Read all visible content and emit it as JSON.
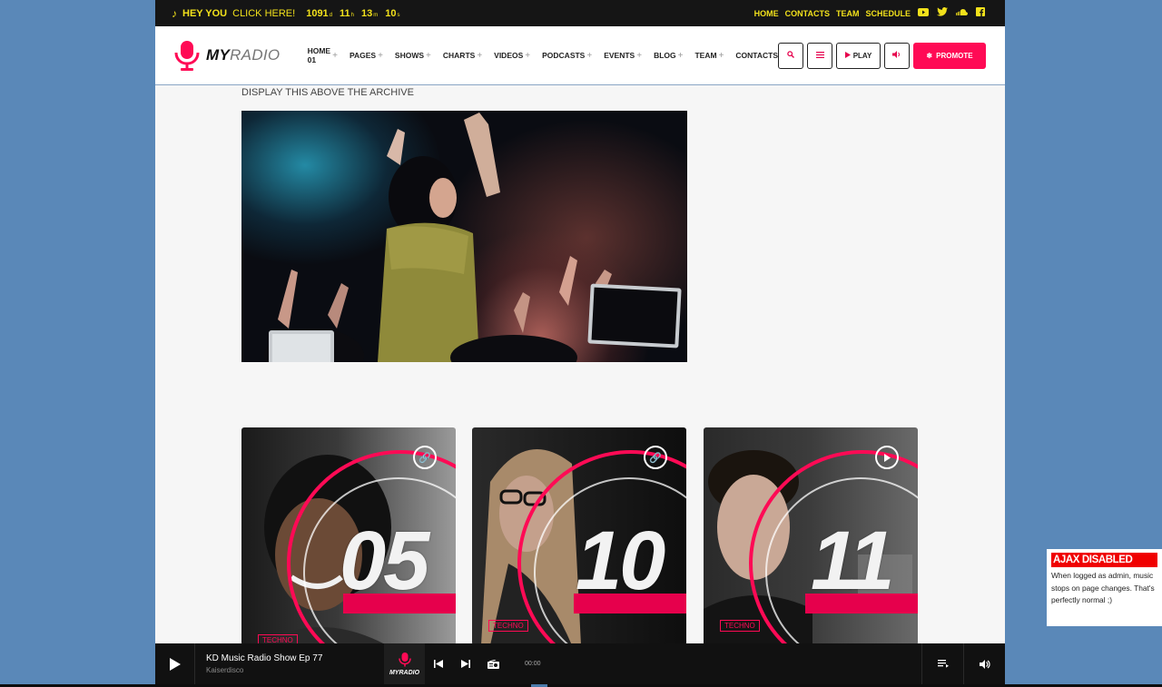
{
  "topbar": {
    "promo_hey": "HEY YOU",
    "promo_click": "CLICK HERE!",
    "countdown": [
      {
        "value": "1091",
        "unit": "d"
      },
      {
        "value": "11",
        "unit": "h"
      },
      {
        "value": "13",
        "unit": "m"
      },
      {
        "value": "10",
        "unit": "s"
      }
    ],
    "links": [
      "HOME",
      "CONTACTS",
      "TEAM",
      "SCHEDULE"
    ],
    "accent": "#f2e11b"
  },
  "header": {
    "logo_my": "MY",
    "logo_radio": "RADIO",
    "nav": [
      "HOME 01",
      "PAGES",
      "SHOWS",
      "CHARTS",
      "VIDEOS",
      "PODCASTS",
      "EVENTS",
      "BLOG",
      "TEAM",
      "CONTACTS"
    ],
    "play_label": "PLAY",
    "promote_label": "PROMOTE",
    "brand_color": "#ff0a55"
  },
  "main": {
    "archive_title": "DISPLAY THIS ABOVE THE ARCHIVE",
    "cards": [
      {
        "number": "05",
        "tag": "TECHNO",
        "icon": "link-icon"
      },
      {
        "number": "10",
        "tag": "TECHNO",
        "icon": "link-icon"
      },
      {
        "number": "11",
        "tag": "TECHNO",
        "icon": "play-icon"
      }
    ]
  },
  "player": {
    "title": "KD Music Radio Show Ep 77",
    "artist": "Kaiserdisco",
    "thumb_label": "MYRADIO",
    "time": "00:00"
  },
  "ajax_notice": {
    "title": "AJAX DISABLED",
    "text": "When logged as admin, music stops on page changes. That's perfectly normal ;)"
  }
}
